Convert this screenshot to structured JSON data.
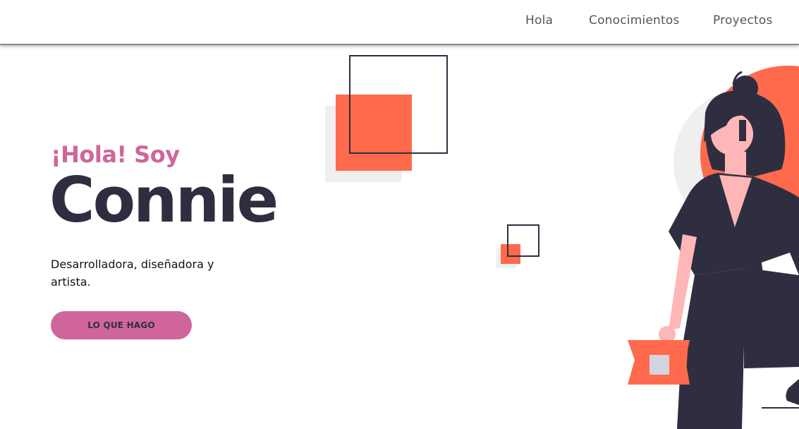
{
  "nav": {
    "items": [
      {
        "label": "Hola"
      },
      {
        "label": "Conocimientos"
      },
      {
        "label": "Proyectos"
      }
    ]
  },
  "hero": {
    "greeting": "¡Hola! Soy",
    "name": "Connie",
    "tagline": "Desarrolladora, diseñadora y artista.",
    "cta_label": "LO QUE HAGO"
  },
  "colors": {
    "accent_pink": "#d0659b",
    "accent_orange": "#ff6a4d",
    "dark": "#2f2e41",
    "skin": "#ffb6b6"
  },
  "icons": {
    "illustration": "woman-with-bag-illustration"
  }
}
